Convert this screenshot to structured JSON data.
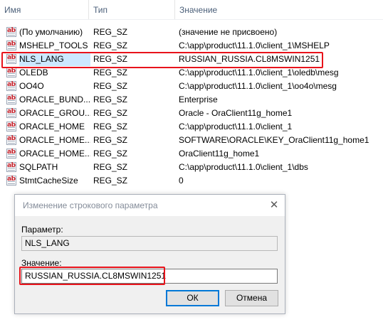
{
  "columns": {
    "name": "Имя",
    "type": "Тип",
    "value": "Значение"
  },
  "rows": [
    {
      "name": "(По умолчанию)",
      "type": "REG_SZ",
      "value": "(значение не присвоено)"
    },
    {
      "name": "MSHELP_TOOLS",
      "type": "REG_SZ",
      "value": "C:\\app\\product\\11.1.0\\client_1\\MSHELP"
    },
    {
      "name": "NLS_LANG",
      "type": "REG_SZ",
      "value": "RUSSIAN_RUSSIA.CL8MSWIN1251"
    },
    {
      "name": "OLEDB",
      "type": "REG_SZ",
      "value": "C:\\app\\product\\11.1.0\\client_1\\oledb\\mesg"
    },
    {
      "name": "OO4O",
      "type": "REG_SZ",
      "value": "C:\\app\\product\\11.1.0\\client_1\\oo4o\\mesg"
    },
    {
      "name": "ORACLE_BUND...",
      "type": "REG_SZ",
      "value": "Enterprise"
    },
    {
      "name": "ORACLE_GROU...",
      "type": "REG_SZ",
      "value": "Oracle - OraClient11g_home1"
    },
    {
      "name": "ORACLE_HOME",
      "type": "REG_SZ",
      "value": "C:\\app\\product\\11.1.0\\client_1"
    },
    {
      "name": "ORACLE_HOME...",
      "type": "REG_SZ",
      "value": "SOFTWARE\\ORACLE\\KEY_OraClient11g_home1"
    },
    {
      "name": "ORACLE_HOME...",
      "type": "REG_SZ",
      "value": "OraClient11g_home1"
    },
    {
      "name": "SQLPATH",
      "type": "REG_SZ",
      "value": "C:\\app\\product\\11.1.0\\client_1\\dbs"
    },
    {
      "name": "StmtCacheSize",
      "type": "REG_SZ",
      "value": "0"
    }
  ],
  "icon_text": "ab",
  "dialog": {
    "title": "Изменение строкового параметра",
    "close_glyph": "✕",
    "param_label": "Параметр:",
    "param_value": "NLS_LANG",
    "value_label": "Значение:",
    "value_value": "RUSSIAN_RUSSIA.CL8MSWIN1251",
    "ok_label": "ОК",
    "cancel_label": "Отмена"
  },
  "colors": {
    "highlight": "#e8131b",
    "accent": "#0078d7"
  }
}
